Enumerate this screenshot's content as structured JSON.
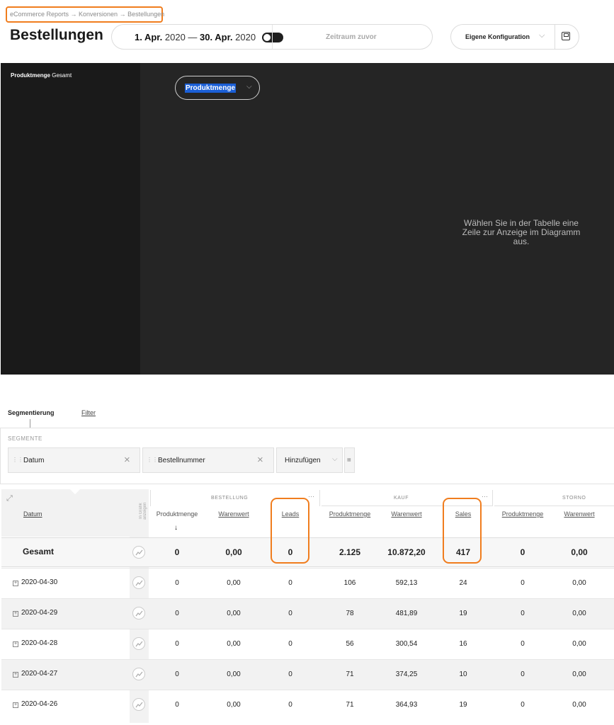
{
  "breadcrumb": "eCommerce Reports → Konversionen → Bestellungen",
  "page_title": "Bestellungen",
  "date_range": {
    "start_bold": "1. Apr.",
    "start_year": " 2020",
    "dash": " — ",
    "end_bold": "30. Apr.",
    "end_year": " 2020",
    "compare_label": "Zeitraum zuvor",
    "compare_enabled": false
  },
  "config": {
    "label": "Eigene Konfiguration"
  },
  "chart": {
    "side_title_bold": "Produktmenge",
    "side_title_rest": " Gesamt",
    "metric_selected": "Produktmenge",
    "empty_message": "Wählen Sie in der Tabelle eine Zeile zur Anzeige im Diagramm aus."
  },
  "tabs": {
    "segmentation": "Segmentierung",
    "filter": "Filter"
  },
  "segments": {
    "header": "SEGMENTE",
    "chips": [
      "Datum",
      "Bestellnummer"
    ],
    "add_label": "Hinzufügen"
  },
  "table": {
    "date_col": "Datum",
    "in_graph_label": "In Grafik anzeigen",
    "groups": [
      {
        "label": "BESTELLUNG"
      },
      {
        "label": "KAUF"
      },
      {
        "label": "STORNO"
      }
    ],
    "columns": [
      "Produktmenge",
      "Warenwert",
      "Leads",
      "Produktmenge",
      "Warenwert",
      "Sales",
      "Produktmenge",
      "Warenwert"
    ],
    "total_label": "Gesamt",
    "total": [
      "0",
      "0,00",
      "0",
      "2.125",
      "10.872,20",
      "417",
      "0",
      "0,00"
    ],
    "rows": [
      {
        "date": "2020-04-30",
        "values": [
          "0",
          "0,00",
          "0",
          "106",
          "592,13",
          "24",
          "0",
          "0,00"
        ]
      },
      {
        "date": "2020-04-29",
        "values": [
          "0",
          "0,00",
          "0",
          "78",
          "481,89",
          "19",
          "0",
          "0,00"
        ]
      },
      {
        "date": "2020-04-28",
        "values": [
          "0",
          "0,00",
          "0",
          "56",
          "300,54",
          "16",
          "0",
          "0,00"
        ]
      },
      {
        "date": "2020-04-27",
        "values": [
          "0",
          "0,00",
          "0",
          "71",
          "374,25",
          "10",
          "0",
          "0,00"
        ]
      },
      {
        "date": "2020-04-26",
        "values": [
          "0",
          "0,00",
          "0",
          "71",
          "364,93",
          "19",
          "0",
          "0,00"
        ]
      }
    ]
  },
  "colors": {
    "highlight": "#f07d1e",
    "chart_bg": "#252525",
    "select_highlight": "#1b5fd6"
  }
}
